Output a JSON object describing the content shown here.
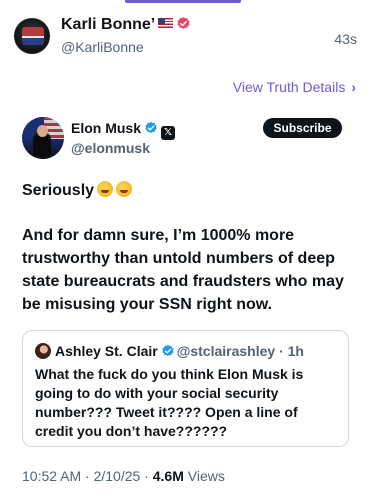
{
  "post": {
    "author_name": "Karli Bonne’",
    "author_handle": "@KarliBonne",
    "timestamp": "43s",
    "avatar_text": "Karli Bonne",
    "view_details_label": "View Truth Details",
    "accent_color": "#6f5bd8"
  },
  "tweet": {
    "name": "Elon Musk",
    "handle": "@elonmusk",
    "subscribe_label": "Subscribe",
    "line1": "Seriously",
    "paragraph": "And for damn sure, I’m 1000% more trustworthy than untold numbers of deep state bureaucrats and fraudsters who may be misusing your SSN right now.",
    "date_time": "10:52 AM · 2/10/25 · ",
    "views_count": "4.6M",
    "views_label": "Views"
  },
  "quote": {
    "name": "Ashley St. Clair",
    "handle_time": "@stclairashley · 1h",
    "text": "What the fuck do you think Elon Musk is going to do with your social security number??? Tweet it???? Open a line of credit you don’t have??????"
  },
  "icons": {
    "flag": "us-flag-icon",
    "pink_badge": "verified-badge-icon",
    "blue_badge": "verified-badge-icon",
    "x": "x-logo-icon",
    "emoji": "rofl-emoji-icon",
    "chevron": "chevron-right-icon"
  }
}
